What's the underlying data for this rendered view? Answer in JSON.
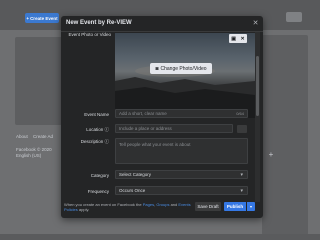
{
  "topbar": {
    "create_button_label": "Create Event"
  },
  "background": {
    "text_items": [
      "About",
      "Create Ad",
      "Facebook © 2020",
      "English (US)"
    ]
  },
  "modal": {
    "title": "New Event by Re-VIEW",
    "close_icon": "close-icon",
    "photo": {
      "label": "Event Photo or Video",
      "change_button_label": "Change Photo/Video",
      "camera_icon": "camera-icon",
      "tool_icons": [
        "crop-icon",
        "close-icon"
      ]
    },
    "fields": {
      "event_name": {
        "label": "Event Name",
        "placeholder": "Add a short, clear name",
        "char_limit": "0/64"
      },
      "location": {
        "label": "Location",
        "placeholder": "Include a place or address",
        "info_icon": "info-icon"
      },
      "description": {
        "label": "Description",
        "placeholder": "Tell people what your event is about"
      },
      "category": {
        "label": "Category",
        "value": "Select Category",
        "chevron_icon": "chevron-down-icon"
      },
      "frequency": {
        "label": "Frequency",
        "value": "Occurs Once",
        "chevron_icon": "chevron-down-icon"
      }
    },
    "footer": {
      "notice_prefix": "When you create an event on Facebook the",
      "link_pages": "Pages",
      "notice_mid": ",",
      "link_groups": "Groups",
      "notice_and": "and",
      "link_policies": "Events Policies",
      "notice_suffix": "apply.",
      "save_draft_label": "Save Draft",
      "publish_label": "Publish"
    }
  },
  "colors": {
    "accent": "#3578e5",
    "modal_bg": "#242526",
    "overlay": "#6e6f71"
  }
}
